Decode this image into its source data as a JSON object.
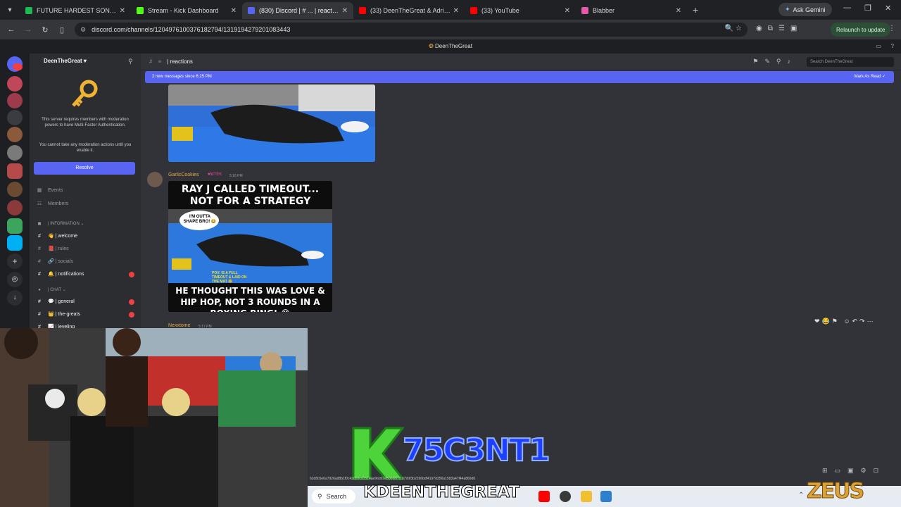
{
  "browser": {
    "tabs": [
      {
        "label": "FUTURE HARDEST SONGS 🔵🔥",
        "favicon_color": "#1db954",
        "active": false
      },
      {
        "label": "Stream - Kick Dashboard",
        "favicon_color": "#53fc18",
        "active": false
      },
      {
        "label": "(830) Discord | # ... | reactions",
        "favicon_color": "#5865f2",
        "active": true
      },
      {
        "label": "(33) DeenTheGreat & Adrien B...",
        "favicon_color": "#ff0000",
        "active": false
      },
      {
        "label": "(33) YouTube",
        "favicon_color": "#ff0000",
        "active": false
      },
      {
        "label": "Blabber",
        "favicon_color": "#e25aa8",
        "active": false
      }
    ],
    "ask_gemini": "Ask Gemini",
    "url": "discord.com/channels/1204976100376182794/1319194279201083443",
    "relaunch": "Relaunch to update"
  },
  "discord": {
    "window_title": "DeenTheGreat",
    "server_name": "DeenTheGreat",
    "mfa_notice": "This server requires members with moderation powers to have Multi-Factor Authentication.",
    "mfa_notice2": "You cannot take any moderation actions until you enable it.",
    "resolve_label": "Resolve",
    "nav": [
      {
        "label": "Events",
        "icon": "calendar-icon"
      },
      {
        "label": "Members",
        "icon": "members-icon"
      }
    ],
    "categories": [
      {
        "label": "| INFORMATION",
        "channels": [
          {
            "label": "| welcome",
            "emoji": "👋"
          },
          {
            "label": "| rules",
            "emoji": "📕"
          },
          {
            "label": "| socials",
            "emoji": "🔗"
          },
          {
            "label": "| notifications",
            "emoji": "🔔"
          }
        ]
      },
      {
        "label": "| CHAT",
        "channels": [
          {
            "label": "| general",
            "emoji": "💬"
          },
          {
            "label": "| the-greats",
            "emoji": "👑"
          },
          {
            "label": "| leveling",
            "emoji": "📈"
          }
        ]
      }
    ],
    "channel_name": "| reactions",
    "search_placeholder": "Search DeenTheGreat",
    "new_messages": "2 new messages since 6:25 PM",
    "mark_as_read": "Mark As Read",
    "messages": [
      {
        "author": "GarlicCookies",
        "tag": "MTEK",
        "time": "5:16 PM",
        "meme_top": "RAY J CALLED TIMEOUT... NOT FOR A STRATEGY",
        "meme_bubble": "I'M OUTTA SHAPE BRO! 😂",
        "meme_note": "POV: IS A FULL TIMEOUT & LAID ON THE MAT 😂",
        "meme_bottom": "HE THOUGHT THIS WAS LOVE & HIP HOP, NOT 3 ROUNDS IN A BOXING RING! 😂"
      },
      {
        "author": "Nexxtome",
        "time": "5:17 PM"
      }
    ]
  },
  "overlay": {
    "code": "75C3NT1",
    "name": "KDEENTHEGREAT",
    "hash": "62d8c6e6a7926ad8b1f0c43d95cd1514ae96d92e500880110799f3b2296bdf4197d356a1583a47f44a869d6",
    "brand": "ZEUS"
  },
  "taskbar": {
    "search": "Search"
  }
}
